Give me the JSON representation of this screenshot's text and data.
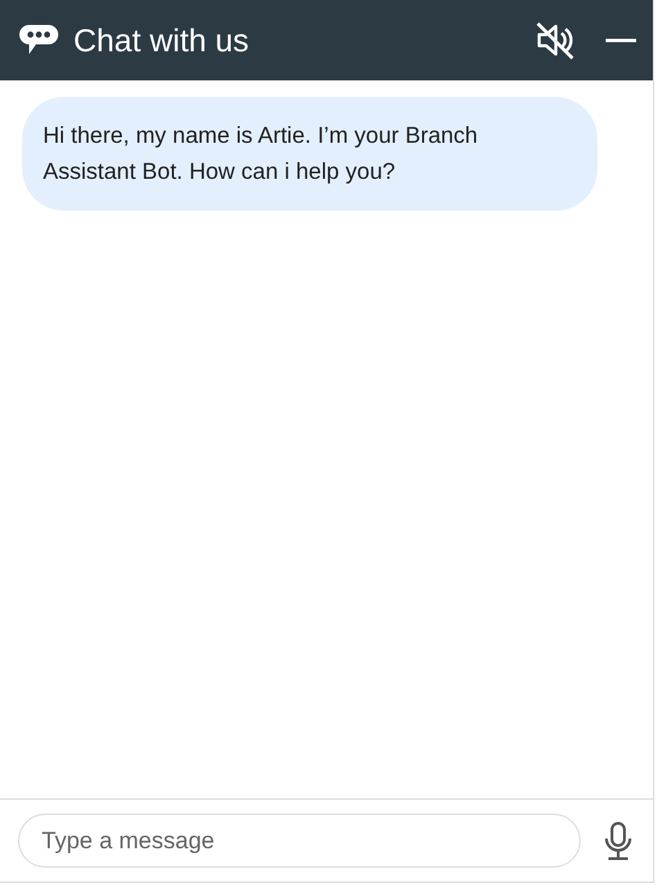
{
  "header": {
    "title": "Chat with us",
    "sound_muted": true
  },
  "messages": [
    {
      "kind": "bot",
      "text": "Hi there, my name is Artie. I’m your Branch Assistant Bot. How can i help you?"
    }
  ],
  "composer": {
    "placeholder": "Type a message"
  }
}
